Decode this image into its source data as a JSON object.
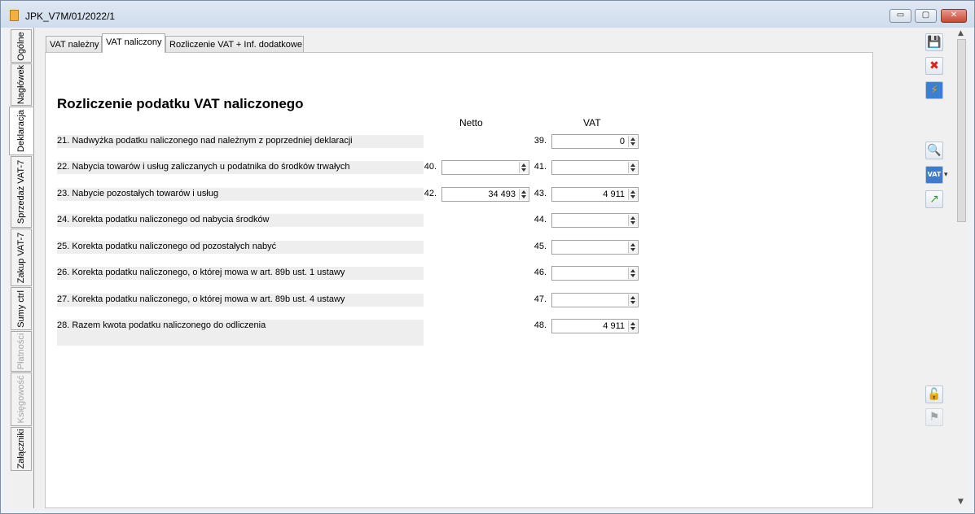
{
  "window": {
    "title": "JPK_V7M/01/2022/1",
    "minimize_symbol": "▭",
    "maximize_symbol": "▢",
    "close_symbol": "✕"
  },
  "vertical_tabs": [
    {
      "label": "Ogólne",
      "enabled": true,
      "active": false
    },
    {
      "label": "Nagłówek",
      "enabled": true,
      "active": false
    },
    {
      "label": "Deklaracja",
      "enabled": true,
      "active": true
    },
    {
      "label": "Sprzedaż VAT-7",
      "enabled": true,
      "active": false
    },
    {
      "label": "Zakup VAT-7",
      "enabled": true,
      "active": false
    },
    {
      "label": "Sumy ctrl",
      "enabled": true,
      "active": false
    },
    {
      "label": "Płatności",
      "enabled": false,
      "active": false
    },
    {
      "label": "Księgowość",
      "enabled": false,
      "active": false
    },
    {
      "label": "Załączniki",
      "enabled": true,
      "active": false
    }
  ],
  "tabs": [
    {
      "label": "VAT należny",
      "active": false
    },
    {
      "label": "VAT naliczony",
      "active": true
    },
    {
      "label": "Rozliczenie VAT + Inf. dodatkowe",
      "active": false
    }
  ],
  "form": {
    "heading": "Rozliczenie podatku VAT naliczonego",
    "netto_header": "Netto",
    "vat_header": "VAT",
    "rows": [
      {
        "label": "21. Nadwyżka podatku naliczonego nad należnym z poprzedniej deklaracji",
        "netto_num": "",
        "netto_value": null,
        "vat_num": "39.",
        "vat_value": "0"
      },
      {
        "label": "22. Nabycia towarów i usług zaliczanych u podatnika do środków trwałych",
        "netto_num": "40.",
        "netto_value": "",
        "vat_num": "41.",
        "vat_value": ""
      },
      {
        "label": "23. Nabycie pozostałych towarów i usług",
        "netto_num": "42.",
        "netto_value": "34 493",
        "vat_num": "43.",
        "vat_value": "4 911"
      },
      {
        "label": "24.  Korekta podatku naliczonego od nabycia środków",
        "netto_num": "",
        "netto_value": null,
        "vat_num": "44.",
        "vat_value": ""
      },
      {
        "label": "25. Korekta podatku naliczonego od pozostałych nabyć",
        "netto_num": "",
        "netto_value": null,
        "vat_num": "45.",
        "vat_value": ""
      },
      {
        "label": "26. Korekta podatku naliczonego, o której mowa w art. 89b ust. 1 ustawy",
        "netto_num": "",
        "netto_value": null,
        "vat_num": "46.",
        "vat_value": ""
      },
      {
        "label": "27. Korekta podatku naliczonego, o której mowa w art. 89b ust. 4 ustawy",
        "netto_num": "",
        "netto_value": null,
        "vat_num": "47.",
        "vat_value": ""
      },
      {
        "label": "28.  Razem kwota podatku naliczonego do odliczenia",
        "netto_num": "",
        "netto_value": null,
        "vat_num": "48.",
        "vat_value": "4 911"
      }
    ]
  },
  "toolbar": {
    "save_icon": "💾",
    "cancel_icon": "✖",
    "calculate_icon": "⚡",
    "preview_icon": "🔍",
    "vat_icon": "VAT",
    "export_icon": "↗",
    "lock_icon": "🔓",
    "flag_icon": "⚑",
    "dropdown_symbol": "▾"
  },
  "scrollbar": {
    "up": "▲",
    "down": "▼"
  }
}
